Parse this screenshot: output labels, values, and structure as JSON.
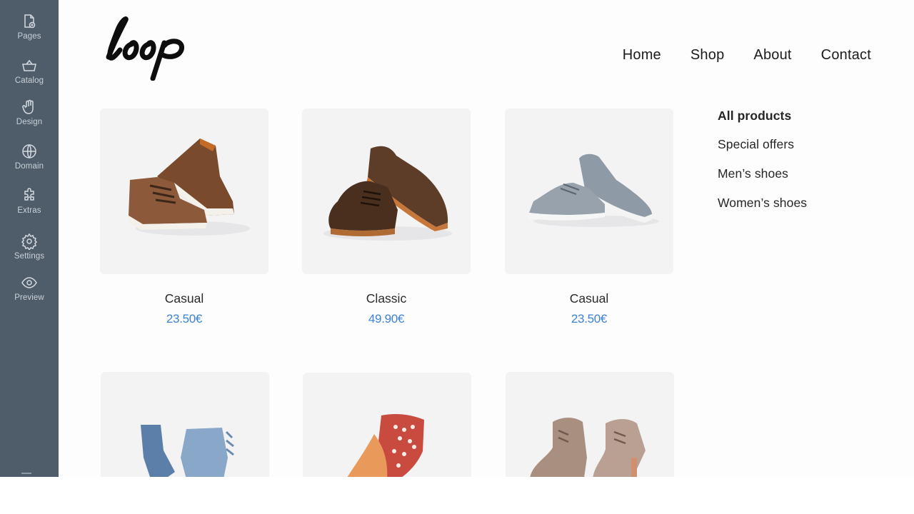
{
  "sidebar": {
    "items": [
      {
        "label": "Pages",
        "icon": "pages-icon"
      },
      {
        "label": "Catalog",
        "icon": "basket-icon"
      },
      {
        "label": "Design",
        "icon": "hand-icon"
      },
      {
        "label": "Domain",
        "icon": "globe-icon"
      },
      {
        "label": "Extras",
        "icon": "puzzle-icon"
      },
      {
        "label": "Settings",
        "icon": "gear-icon"
      },
      {
        "label": "Preview",
        "icon": "eye-icon"
      }
    ]
  },
  "site": {
    "logo_text": "loop",
    "nav": [
      "Home",
      "Shop",
      "About",
      "Contact"
    ],
    "categories": [
      {
        "label": "All products",
        "active": true
      },
      {
        "label": "Special offers",
        "active": false
      },
      {
        "label": "Men’s shoes",
        "active": false
      },
      {
        "label": "Women’s shoes",
        "active": false
      }
    ],
    "products": [
      {
        "name": "Casual",
        "price": "23.50€",
        "image": "brown-chukka-boots"
      },
      {
        "name": "Classic",
        "price": "49.90€",
        "image": "brown-oxford-shoes"
      },
      {
        "name": "Casual",
        "price": "23.50€",
        "image": "grey-sneakers"
      },
      {
        "name": "",
        "price": "",
        "image": "blue-denim-boots"
      },
      {
        "name": "",
        "price": "",
        "image": "red-white-heels"
      },
      {
        "name": "",
        "price": "",
        "image": "beige-ankle-boots"
      }
    ]
  },
  "colors": {
    "sidebar_bg": "#4f5d6b",
    "price": "#3d82d6",
    "tile_bg": "#f3f3f4"
  }
}
